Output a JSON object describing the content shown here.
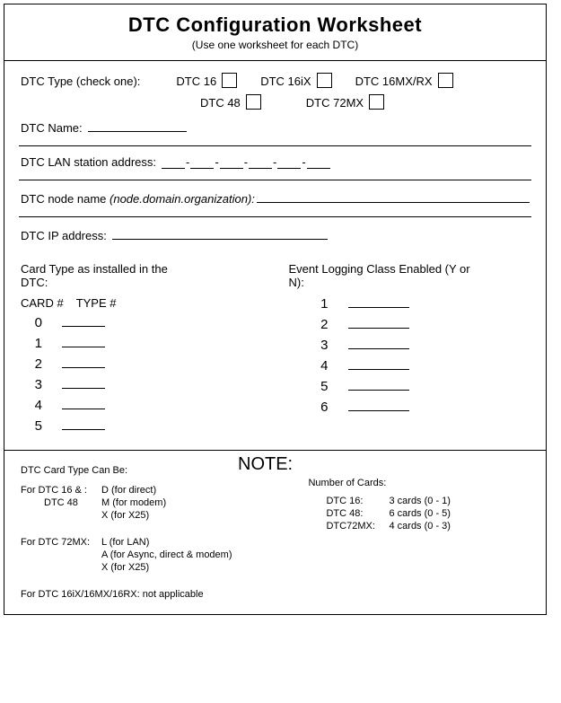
{
  "header": {
    "title": "DTC Configuration Worksheet",
    "subtitle": "(Use one worksheet for each DTC)"
  },
  "type_section": {
    "label": "DTC Type (check one):",
    "options_row1": [
      "DTC 16",
      "DTC 16iX",
      "DTC 16MX/RX"
    ],
    "options_row2": [
      "DTC 48",
      "DTC 72MX"
    ]
  },
  "fields": {
    "dtc_name": "DTC Name:",
    "lan_addr": "DTC LAN station address:",
    "node_name_label": "DTC node name",
    "node_name_hint": "(node.domain.organization):",
    "ip_addr": "DTC IP address:"
  },
  "cards": {
    "heading": "Card Type as installed in the DTC:",
    "col_card": "CARD #",
    "col_type": "TYPE #",
    "rows": [
      "0",
      "1",
      "2",
      "3",
      "4",
      "5"
    ]
  },
  "events": {
    "heading": "Event Logging Class Enabled (Y or N):",
    "rows": [
      "1",
      "2",
      "3",
      "4",
      "5",
      "6"
    ]
  },
  "notes": {
    "title": "NOTE:",
    "left_heading": "DTC Card Type Can Be:",
    "group1_label": "For DTC 16 & :",
    "group1_line1": "D (for direct)",
    "group1_sub": "DTC 48",
    "group1_line2": "M (for modem)",
    "group1_line3": "X (for X25)",
    "group2_label": "For DTC 72MX:",
    "group2_line1": "L (for LAN)",
    "group2_line2": "A (for Async, direct & modem)",
    "group2_line3": "X (for X25)",
    "group3": "For DTC 16iX/16MX/16RX: not applicable",
    "right_heading": "Number of Cards:",
    "nc": [
      {
        "l": "DTC 16:",
        "r": "3 cards (0 - 1)"
      },
      {
        "l": "DTC 48:",
        "r": "6 cards (0 - 5)"
      },
      {
        "l": "DTC72MX:",
        "r": "4 cards (0 - 3)"
      }
    ]
  }
}
